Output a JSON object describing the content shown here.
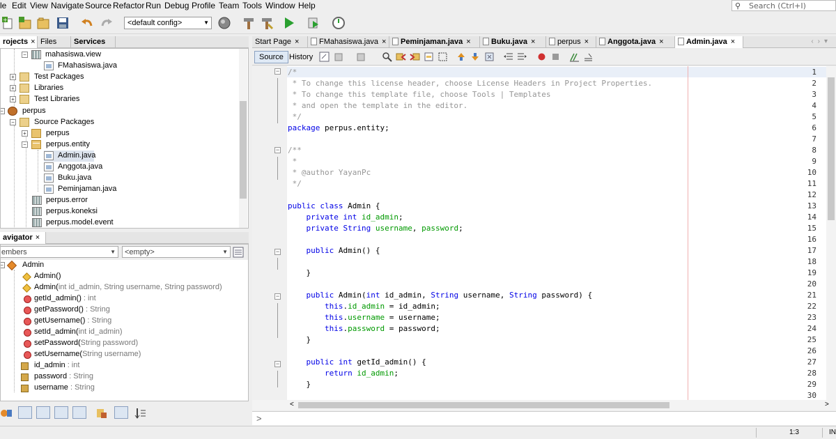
{
  "menubar": {
    "items": [
      "le",
      "Edit",
      "View",
      "Navigate",
      "Source",
      "Refactor",
      "Run",
      "Debug",
      "Profile",
      "Team",
      "Tools",
      "Window",
      "Help"
    ],
    "search_placeholder": "Search (Ctrl+I)"
  },
  "toolbar": {
    "config": "<default config>"
  },
  "projects_panel": {
    "tabs": [
      "rojects",
      "Files",
      "Services"
    ],
    "tree": [
      {
        "label": "mahasiswa.view",
        "icon": "grid"
      },
      {
        "label": "FMahasiswa.java",
        "icon": "java"
      },
      {
        "label": "Test Packages",
        "icon": "folder"
      },
      {
        "label": "Libraries",
        "icon": "folder"
      },
      {
        "label": "Test Libraries",
        "icon": "folder"
      },
      {
        "label": "perpus",
        "icon": "project"
      },
      {
        "label": "Source Packages",
        "icon": "folder"
      },
      {
        "label": "perpus",
        "icon": "package"
      },
      {
        "label": "perpus.entity",
        "icon": "package"
      },
      {
        "label": "Admin.java",
        "icon": "java"
      },
      {
        "label": "Anggota.java",
        "icon": "java"
      },
      {
        "label": "Buku.java",
        "icon": "java"
      },
      {
        "label": "Peminjaman.java",
        "icon": "java"
      },
      {
        "label": "perpus.error",
        "icon": "grid"
      },
      {
        "label": "perpus.koneksi",
        "icon": "grid"
      },
      {
        "label": "perpus.model.event",
        "icon": "grid"
      }
    ]
  },
  "navigator": {
    "tab": "avigator",
    "filter_label": "embers",
    "filter_empty": "<empty>",
    "class_name": "Admin",
    "members": [
      {
        "name": "Admin()",
        "sig": "",
        "kind": "ctor"
      },
      {
        "name": "Admin(",
        "sig": "int id_admin, String username, String password)",
        "kind": "ctor"
      },
      {
        "name": "getId_admin()",
        "sig": " : int",
        "kind": "method"
      },
      {
        "name": "getPassword()",
        "sig": " : String",
        "kind": "method"
      },
      {
        "name": "getUsername()",
        "sig": " : String",
        "kind": "method"
      },
      {
        "name": "setId_admin(",
        "sig": "int id_admin)",
        "kind": "method"
      },
      {
        "name": "setPassword(",
        "sig": "String password)",
        "kind": "method"
      },
      {
        "name": "setUsername(",
        "sig": "String username)",
        "kind": "method"
      },
      {
        "name": "id_admin",
        "sig": " : int",
        "kind": "field"
      },
      {
        "name": "password",
        "sig": " : String",
        "kind": "field"
      },
      {
        "name": "username",
        "sig": " : String",
        "kind": "field"
      }
    ]
  },
  "editor": {
    "tabs": [
      {
        "label": "Start Page",
        "bold": false,
        "file_icon": false
      },
      {
        "label": "FMahasiswa.java",
        "bold": false,
        "file_icon": true
      },
      {
        "label": "Peminjaman.java",
        "bold": true,
        "file_icon": true
      },
      {
        "label": "Buku.java",
        "bold": true,
        "file_icon": true
      },
      {
        "label": "perpus",
        "bold": false,
        "file_icon": true
      },
      {
        "label": "Anggota.java",
        "bold": true,
        "file_icon": true
      },
      {
        "label": "Admin.java",
        "bold": true,
        "file_icon": true,
        "active": true
      }
    ],
    "source_label": "Source",
    "history_label": "History",
    "lines": [
      {
        "n": "1",
        "code": "/*",
        "cls": "cm"
      },
      {
        "n": "2",
        "code": " * To change this license header, choose License Headers in Project Properties.",
        "cls": "cm"
      },
      {
        "n": "3",
        "code": " * To change this template file, choose Tools | Templates",
        "cls": "cm"
      },
      {
        "n": "4",
        "code": " * and open the template in the editor.",
        "cls": "cm"
      },
      {
        "n": "5",
        "code": " */",
        "cls": "cm"
      },
      {
        "n": "6",
        "code": "package perpus.entity;",
        "cls": "pkg"
      },
      {
        "n": "7",
        "code": "",
        "cls": ""
      },
      {
        "n": "8",
        "code": "/**",
        "cls": "cm"
      },
      {
        "n": "9",
        "code": " *",
        "cls": "cm"
      },
      {
        "n": "10",
        "code": " * @author YayanPc",
        "cls": "cm"
      },
      {
        "n": "11",
        "code": " */",
        "cls": "cm"
      },
      {
        "n": "12",
        "code": "",
        "cls": ""
      },
      {
        "n": "13",
        "code": "public class Admin {",
        "cls": "cls"
      },
      {
        "n": "14",
        "code": "    private int id_admin;",
        "cls": "f1"
      },
      {
        "n": "15",
        "code": "    private String username, password;",
        "cls": "f2"
      },
      {
        "n": "16",
        "code": "",
        "cls": ""
      },
      {
        "n": "17",
        "code": "    public Admin() {",
        "cls": "c1"
      },
      {
        "n": "18",
        "code": "",
        "cls": ""
      },
      {
        "n": "19",
        "code": "    }",
        "cls": ""
      },
      {
        "n": "20",
        "code": "",
        "cls": ""
      },
      {
        "n": "21",
        "code": "    public Admin(int id_admin, String username, String password) {",
        "cls": "c2"
      },
      {
        "n": "22",
        "code": "        this.id_admin = id_admin;",
        "cls": "t1"
      },
      {
        "n": "23",
        "code": "        this.username = username;",
        "cls": "t2"
      },
      {
        "n": "24",
        "code": "        this.password = password;",
        "cls": "t3"
      },
      {
        "n": "25",
        "code": "    }",
        "cls": ""
      },
      {
        "n": "26",
        "code": "",
        "cls": ""
      },
      {
        "n": "27",
        "code": "    public int getId_admin() {",
        "cls": "g1"
      },
      {
        "n": "28",
        "code": "        return id_admin;",
        "cls": "r1"
      },
      {
        "n": "29",
        "code": "    }",
        "cls": ""
      },
      {
        "n": "30",
        "code": "",
        "cls": ""
      }
    ]
  },
  "status": {
    "caret": "1:3",
    "mode": "IN"
  }
}
